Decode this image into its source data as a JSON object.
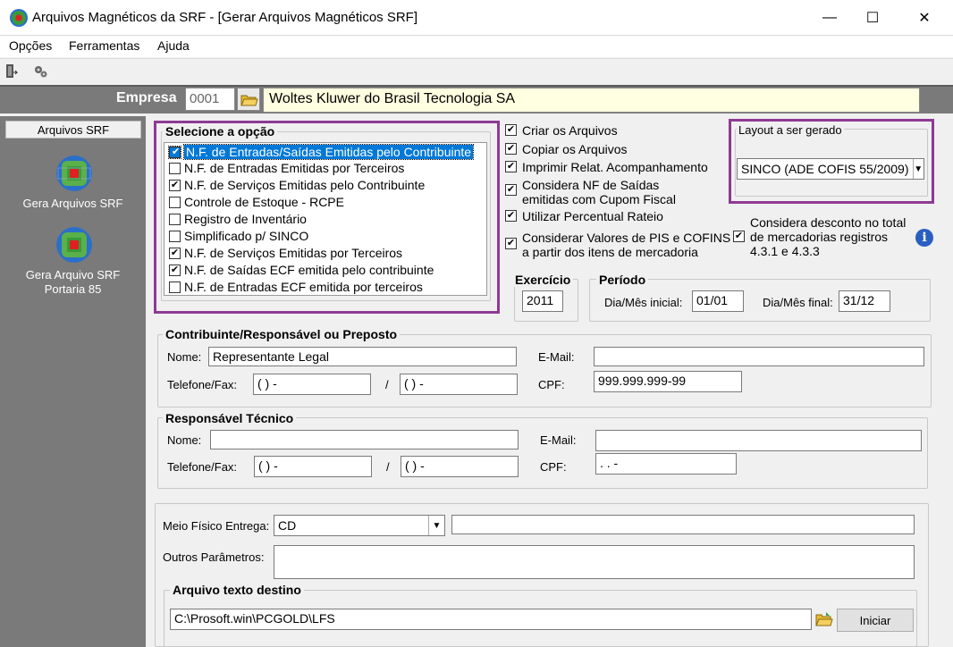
{
  "window": {
    "title": "Arquivos Magnéticos da SRF - [Gerar Arquivos Magnéticos SRF]",
    "minimize": "—",
    "maximize": "☐",
    "close": "✕"
  },
  "menu": {
    "opcoes": "Opções",
    "ferramentas": "Ferramentas",
    "ajuda": "Ajuda"
  },
  "toolbar": {
    "exit_icon": "exit-door-icon",
    "process_icon": "gears-icon"
  },
  "empresa": {
    "label": "Empresa",
    "code": "0001",
    "name": "Woltes Kluwer do Brasil Tecnologia SA"
  },
  "sidebar": {
    "header": "Arquivos SRF",
    "items": [
      {
        "label": "Gera Arquivos SRF"
      },
      {
        "label": "Gera Arquivo SRF Portaria 85"
      }
    ]
  },
  "options": {
    "title": "Selecione a opção",
    "items": [
      {
        "label": "N.F. de Entradas/Saídas Emitidas pelo Contribuinte",
        "checked": true,
        "selected": true
      },
      {
        "label": "N.F. de Entradas Emitidas por Terceiros",
        "checked": false
      },
      {
        "label": "N.F. de Serviços Emitidas pelo Contribuinte",
        "checked": true
      },
      {
        "label": "Controle de Estoque - RCPE",
        "checked": false
      },
      {
        "label": "Registro de Inventário",
        "checked": false
      },
      {
        "label": "Simplificado p/ SINCO",
        "checked": false
      },
      {
        "label": "N.F. de Serviços Emitidas por Terceiros",
        "checked": true
      },
      {
        "label": "N.F. de Saídas ECF emitida pelo contribuinte",
        "checked": true
      },
      {
        "label": "N.F. de Entradas ECF emitida por terceiros",
        "checked": false
      }
    ]
  },
  "flags": {
    "criar": "Criar os Arquivos",
    "copiar": "Copiar os Arquivos",
    "imprimir": "Imprimir Relat. Acompanhamento",
    "considera_nf_1": "Considera NF de Saídas",
    "considera_nf_2": "emitidas com Cupom Fiscal",
    "percentual": "Utilizar Percentual Rateio",
    "pis_1": "Considerar Valores de PIS e COFINS",
    "pis_2": "a partir dos itens de mercadoria",
    "desconto_1": "Considera desconto no total",
    "desconto_2": "de mercadorias registros",
    "desconto_3": "4.3.1 e 4.3.3"
  },
  "layout": {
    "title": "Layout a ser gerado",
    "value": "SINCO (ADE COFIS 55/2009)"
  },
  "exercicio": {
    "title": "Exercício",
    "value": "2011"
  },
  "periodo": {
    "title": "Período",
    "inicial_label": "Dia/Mês inicial:",
    "inicial": "01/01",
    "final_label": "Dia/Mês final:",
    "final": "31/12"
  },
  "contribuinte": {
    "title": "Contribuinte/Responsável ou Preposto",
    "nome_label": "Nome:",
    "nome": "Representante Legal",
    "email_label": "E-Mail:",
    "email": "",
    "telefone_label": "Telefone/Fax:",
    "tel1": "(   )    -",
    "sep": "/",
    "tel2": "(   )    -",
    "cpf_label": "CPF:",
    "cpf": "999.999.999-99"
  },
  "tecnico": {
    "title": "Responsável Técnico",
    "nome_label": "Nome:",
    "nome": "",
    "email_label": "E-Mail:",
    "email": "",
    "telefone_label": "Telefone/Fax:",
    "tel1": "(   )    -",
    "sep": "/",
    "tel2": "(   )    -",
    "cpf_label": "CPF:",
    "cpf": ".     .     -"
  },
  "entrega": {
    "meio_label": "Meio Físico Entrega:",
    "meio": "CD",
    "meio_extra": "",
    "outros_label": "Outros Parâmetros:",
    "outros": ""
  },
  "destino": {
    "title": "Arquivo texto destino",
    "path": "C:\\Prosoft.win\\PCGOLD\\LFS",
    "iniciar": "Iniciar"
  }
}
